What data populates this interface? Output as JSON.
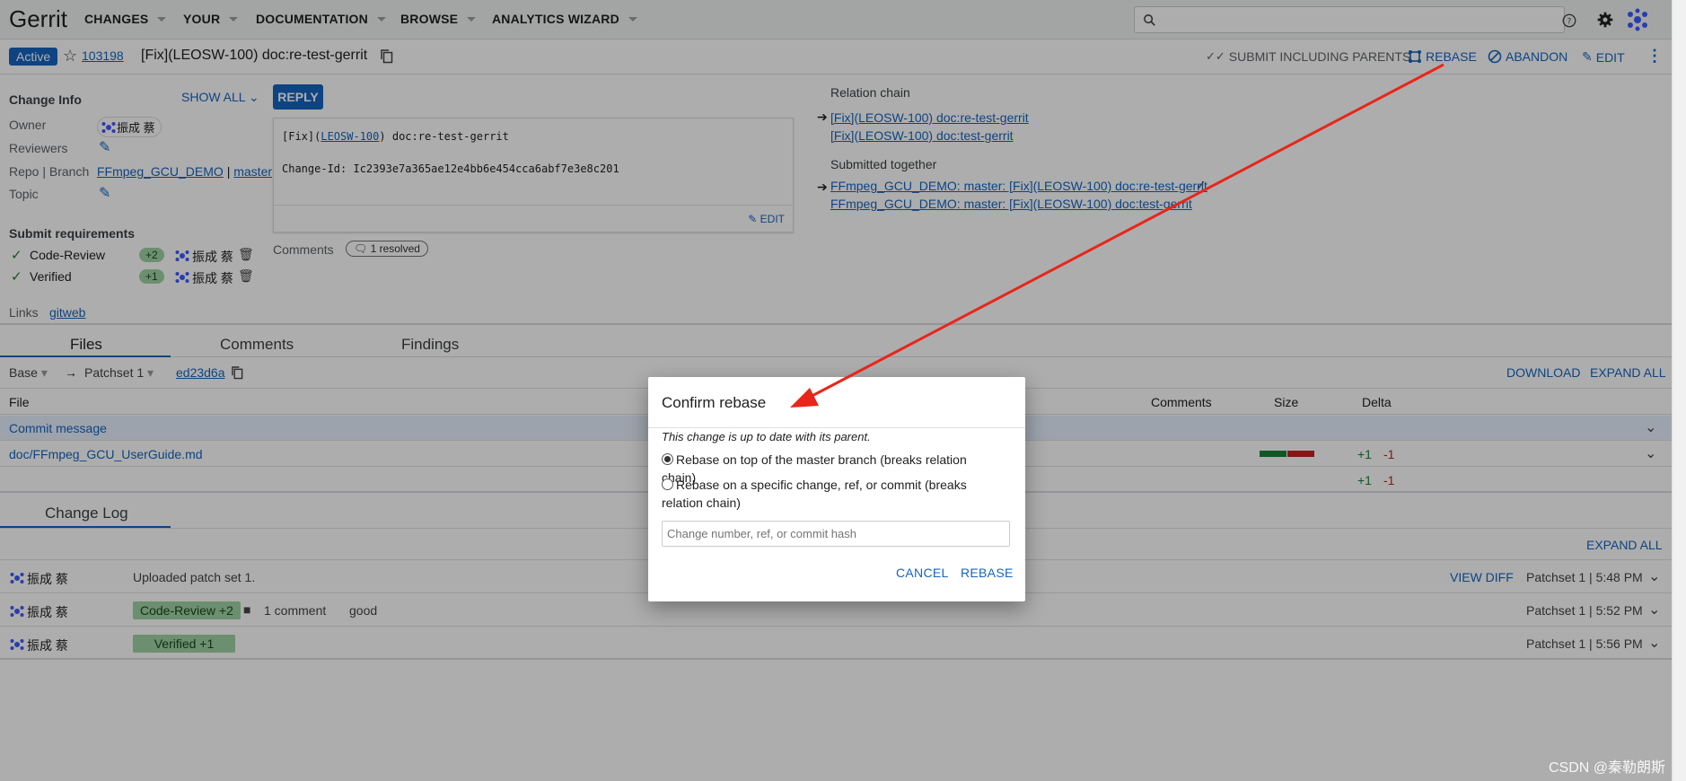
{
  "header": {
    "logo": "Gerrit",
    "nav": [
      "CHANGES",
      "YOUR",
      "DOCUMENTATION",
      "BROWSE",
      "ANALYTICS WIZARD"
    ],
    "search_placeholder": ""
  },
  "change": {
    "status": "Active",
    "number": "103198",
    "subject": "[Fix](LEOSW-100) doc:re-test-gerrit",
    "actions": [
      "SUBMIT INCLUDING PARENTS",
      "REBASE",
      "ABANDON",
      "EDIT"
    ]
  },
  "info": {
    "heading": "Change Info",
    "show_all": "SHOW ALL",
    "owner_label": "Owner",
    "owner": "振成 蔡",
    "reviewers_label": "Reviewers",
    "repo_label": "Repo | Branch",
    "repo": "FFmpeg_GCU_DEMO",
    "repo_sep": "|",
    "branch": "master",
    "topic_label": "Topic",
    "submit_heading": "Submit requirements",
    "requirements": [
      {
        "name": "Code-Review",
        "vote": "+2",
        "user": "振成 蔡"
      },
      {
        "name": "Verified",
        "vote": "+1",
        "user": "振成 蔡"
      }
    ],
    "links_label": "Links",
    "gitweb": "gitweb"
  },
  "commit": {
    "reply": "REPLY",
    "line1_prefix": "[Fix](",
    "line1_link": "LEOSW-100",
    "line1_suffix": ") doc:re-test-gerrit",
    "change_id": "Change-Id: Ic2393e7a365ae12e4bb6e454cca6abf7e3e8c201",
    "edit": "EDIT",
    "comments_label": "Comments",
    "resolved": "1 resolved"
  },
  "relation": {
    "chain_heading": "Relation chain",
    "chain": [
      "[Fix](LEOSW-100) doc:re-test-gerrit",
      "[Fix](LEOSW-100) doc:test-gerrit"
    ],
    "together_heading": "Submitted together",
    "together": [
      "FFmpeg_GCU_DEMO: master: [Fix](LEOSW-100) doc:re-test-gerrit",
      "FFmpeg_GCU_DEMO: master: [Fix](LEOSW-100) doc:test-gerrit"
    ]
  },
  "tabs": [
    "Files",
    "Comments",
    "Findings"
  ],
  "files": {
    "base": "Base",
    "arrow": "→",
    "patchset": "Patchset 1",
    "commit": "ed23d6a",
    "download": "DOWNLOAD",
    "expand_all": "EXPAND ALL",
    "col_file": "File",
    "col_comments": "Comments",
    "col_size": "Size",
    "col_delta": "Delta",
    "rows": [
      {
        "name": "Commit message",
        "plus": "",
        "minus": ""
      },
      {
        "name": "doc/FFmpeg_GCU_UserGuide.md",
        "plus": "+1",
        "minus": "-1"
      }
    ],
    "total_plus": "+1",
    "total_minus": "-1"
  },
  "changelog": {
    "tab": "Change Log",
    "expand_all": "EXPAND ALL",
    "entries": [
      {
        "user": "振成 蔡",
        "text": "Uploaded patch set 1.",
        "chip": "",
        "comment": "",
        "note": "",
        "view_diff": "VIEW DIFF",
        "meta": "Patchset 1 | 5:48 PM"
      },
      {
        "user": "振成 蔡",
        "text": "",
        "chip": "Code-Review +2",
        "comment": "1 comment",
        "note": "good",
        "view_diff": "",
        "meta": "Patchset 1 | 5:52 PM"
      },
      {
        "user": "振成 蔡",
        "text": "",
        "chip": "Verified +1",
        "comment": "",
        "note": "",
        "view_diff": "",
        "meta": "Patchset 1 | 5:56 PM"
      }
    ]
  },
  "dialog": {
    "title": "Confirm rebase",
    "note": "This change is up to date with its parent.",
    "option1": "Rebase on top of the master branch (breaks relation chain)",
    "option2": "Rebase on a specific change, ref, or commit (breaks relation chain)",
    "input_placeholder": "Change number, ref, or commit hash",
    "cancel": "CANCEL",
    "confirm": "REBASE"
  },
  "watermark": "CSDN @秦勒朗斯",
  "colors": {
    "accent": "#1565c0",
    "arrow": "#e8261a",
    "vote": "#9fd3a4"
  }
}
